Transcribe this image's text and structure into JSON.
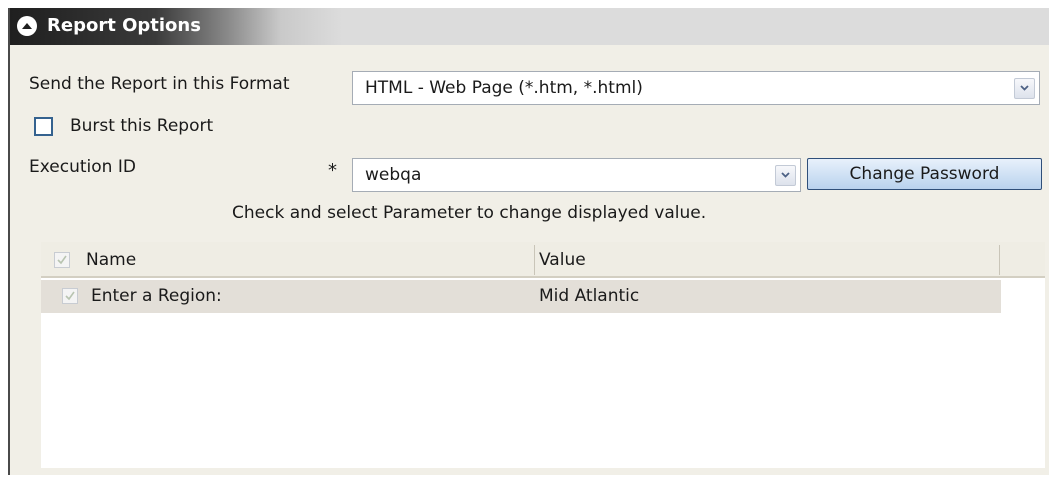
{
  "panel": {
    "title": "Report Options",
    "collapse_icon": "chevron-up-circle-icon"
  },
  "format": {
    "label": "Send the Report in this Format",
    "value": "HTML - Web Page (*.htm, *.html)"
  },
  "burst": {
    "label": "Burst this Report",
    "checked": false
  },
  "execution": {
    "label": "Execution ID",
    "required_marker": "*",
    "value": "webqa",
    "change_password_label": "Change Password"
  },
  "hint": "Check and select Parameter to change displayed value.",
  "parameters": {
    "columns": [
      "Name",
      "Value"
    ],
    "rows": [
      {
        "name": "Enter a Region:",
        "value": "Mid Atlantic",
        "checked": true
      }
    ]
  },
  "colors": {
    "panel_bg": "#f1efe7",
    "title_bar_dark": "#1f1f1f",
    "button_border": "#2f4f7a",
    "checkbox_border": "#35628f"
  }
}
